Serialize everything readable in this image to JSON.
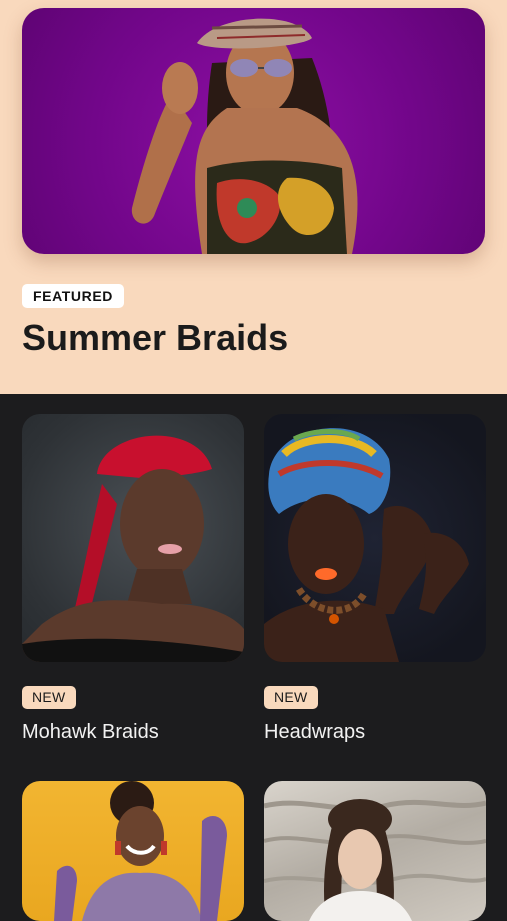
{
  "featured": {
    "badge": "FEATURED",
    "title": "Summer Braids",
    "image_bg": "#7a0792"
  },
  "grid": {
    "items": [
      {
        "badge": "NEW",
        "title": "Mohawk Braids",
        "image": "woman-red-mohawk-braids-photo"
      },
      {
        "badge": "NEW",
        "title": "Headwraps",
        "image": "woman-colorful-headwrap-photo"
      },
      {
        "badge": "",
        "title": "",
        "image": "woman-yellow-background-braids-photo"
      },
      {
        "badge": "",
        "title": "",
        "image": "woman-box-braids-water-photo"
      }
    ]
  },
  "colors": {
    "featured_bg": "#f9d9bd",
    "page_bg": "#1c1c1e",
    "badge_bg": "#f9d9bd"
  }
}
